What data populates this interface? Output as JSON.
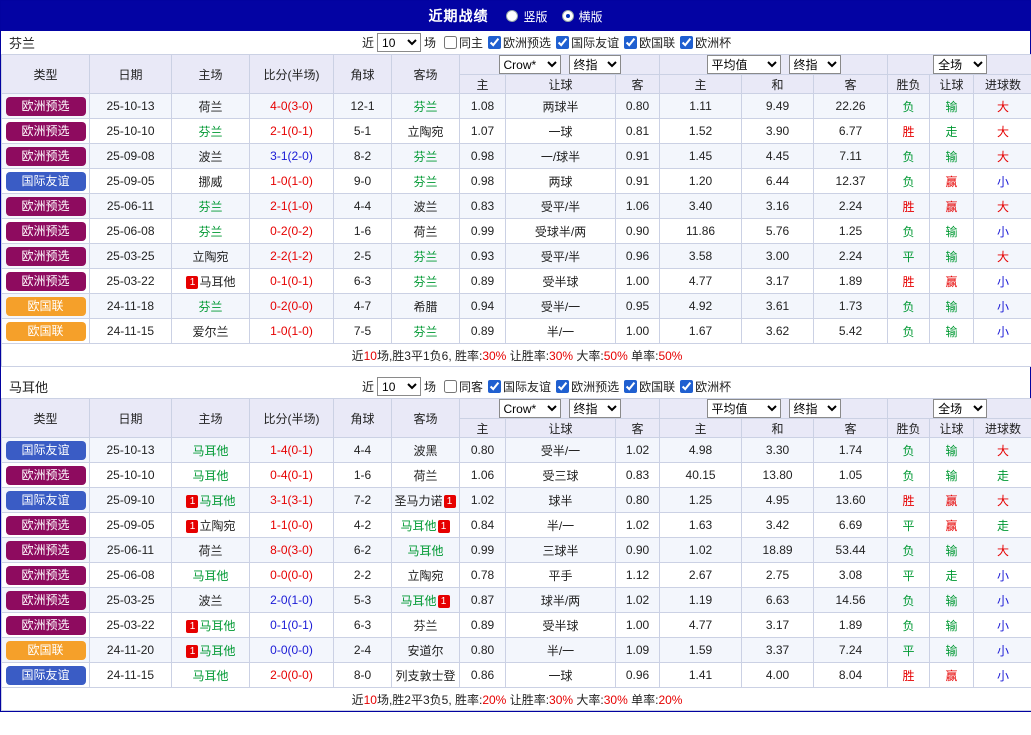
{
  "topbar": {
    "title": "近期战绩",
    "layout_options": [
      {
        "label": "竖版",
        "selected": false
      },
      {
        "label": "横版",
        "selected": true
      }
    ]
  },
  "colors": {
    "badge": {
      "欧洲预选": "#8E0B5F",
      "国际友谊": "#3A5CC5",
      "欧国联": "#F5A02A"
    },
    "status": {
      "red": "#E60000",
      "green": "#009933",
      "blue": "#1A1AD6",
      "black": "#222222"
    },
    "green_team": "#009933"
  },
  "table_headers": {
    "left": [
      "类型",
      "日期",
      "主场",
      "比分(半场)",
      "角球",
      "客场"
    ],
    "asian_sub": [
      "主",
      "让球",
      "客"
    ],
    "euro_sub": [
      "主",
      "和",
      "客"
    ],
    "result_sub": [
      "胜负",
      "让球",
      "进球数"
    ]
  },
  "sections": [
    {
      "team": "芬兰",
      "filter": {
        "near_label": "近",
        "games_value": "10",
        "games_label": "场",
        "same": {
          "label": "同主",
          "checked": false
        },
        "competitions": [
          {
            "label": "欧洲预选",
            "checked": true
          },
          {
            "label": "国际友谊",
            "checked": true
          },
          {
            "label": "欧国联",
            "checked": true
          },
          {
            "label": "欧洲杯",
            "checked": true
          }
        ]
      },
      "dropdowns": {
        "asian": [
          "Crow*",
          "终指"
        ],
        "euro": [
          "平均值",
          "终指"
        ],
        "result": [
          "全场"
        ]
      },
      "rows": [
        {
          "type": "欧洲预选",
          "date": "25-10-13",
          "home": {
            "name": "荷兰"
          },
          "score": [
            "4-0(3-0)",
            "red"
          ],
          "corner": "12-1",
          "away": {
            "name": "芬兰",
            "green": true
          },
          "asian": [
            "1.08",
            "两球半",
            "0.80"
          ],
          "euro": [
            "1.11",
            "9.49",
            "22.26"
          ],
          "results": [
            [
              "负",
              "green"
            ],
            [
              "输",
              "green"
            ],
            [
              "大",
              "red"
            ]
          ]
        },
        {
          "type": "欧洲预选",
          "date": "25-10-10",
          "home": {
            "name": "芬兰",
            "green": true
          },
          "score": [
            "2-1(0-1)",
            "red"
          ],
          "corner": "5-1",
          "away": {
            "name": "立陶宛"
          },
          "asian": [
            "1.07",
            "一球",
            "0.81"
          ],
          "euro": [
            "1.52",
            "3.90",
            "6.77"
          ],
          "results": [
            [
              "胜",
              "red"
            ],
            [
              "走",
              "green"
            ],
            [
              "大",
              "red"
            ]
          ]
        },
        {
          "type": "欧洲预选",
          "date": "25-09-08",
          "home": {
            "name": "波兰"
          },
          "score": [
            "3-1(2-0)",
            "blue"
          ],
          "corner": "8-2",
          "away": {
            "name": "芬兰",
            "green": true
          },
          "asian": [
            "0.98",
            "一/球半",
            "0.91"
          ],
          "euro": [
            "1.45",
            "4.45",
            "7.11"
          ],
          "results": [
            [
              "负",
              "green"
            ],
            [
              "输",
              "green"
            ],
            [
              "大",
              "red"
            ]
          ]
        },
        {
          "type": "国际友谊",
          "date": "25-09-05",
          "home": {
            "name": "挪威"
          },
          "score": [
            "1-0(1-0)",
            "red"
          ],
          "corner": "9-0",
          "away": {
            "name": "芬兰",
            "green": true
          },
          "asian": [
            "0.98",
            "两球",
            "0.91"
          ],
          "euro": [
            "1.20",
            "6.44",
            "12.37"
          ],
          "results": [
            [
              "负",
              "green"
            ],
            [
              "赢",
              "red"
            ],
            [
              "小",
              "blue"
            ]
          ]
        },
        {
          "type": "欧洲预选",
          "date": "25-06-11",
          "home": {
            "name": "芬兰",
            "green": true
          },
          "score": [
            "2-1(1-0)",
            "red"
          ],
          "corner": "4-4",
          "away": {
            "name": "波兰"
          },
          "asian": [
            "0.83",
            "受平/半",
            "1.06"
          ],
          "euro": [
            "3.40",
            "3.16",
            "2.24"
          ],
          "results": [
            [
              "胜",
              "red"
            ],
            [
              "赢",
              "red"
            ],
            [
              "大",
              "red"
            ]
          ]
        },
        {
          "type": "欧洲预选",
          "date": "25-06-08",
          "home": {
            "name": "芬兰",
            "green": true
          },
          "score": [
            "0-2(0-2)",
            "red"
          ],
          "corner": "1-6",
          "away": {
            "name": "荷兰"
          },
          "asian": [
            "0.99",
            "受球半/两",
            "0.90"
          ],
          "euro": [
            "11.86",
            "5.76",
            "1.25"
          ],
          "results": [
            [
              "负",
              "green"
            ],
            [
              "输",
              "green"
            ],
            [
              "小",
              "blue"
            ]
          ]
        },
        {
          "type": "欧洲预选",
          "date": "25-03-25",
          "home": {
            "name": "立陶宛"
          },
          "score": [
            "2-2(1-2)",
            "red"
          ],
          "corner": "2-5",
          "away": {
            "name": "芬兰",
            "green": true
          },
          "asian": [
            "0.93",
            "受平/半",
            "0.96"
          ],
          "euro": [
            "3.58",
            "3.00",
            "2.24"
          ],
          "results": [
            [
              "平",
              "green"
            ],
            [
              "输",
              "green"
            ],
            [
              "大",
              "red"
            ]
          ]
        },
        {
          "type": "欧洲预选",
          "date": "25-03-22",
          "home": {
            "name": "马耳他",
            "card_before": "1"
          },
          "score": [
            "0-1(0-1)",
            "red"
          ],
          "corner": "6-3",
          "away": {
            "name": "芬兰",
            "green": true
          },
          "asian": [
            "0.89",
            "受半球",
            "1.00"
          ],
          "euro": [
            "4.77",
            "3.17",
            "1.89"
          ],
          "results": [
            [
              "胜",
              "red"
            ],
            [
              "赢",
              "red"
            ],
            [
              "小",
              "blue"
            ]
          ]
        },
        {
          "type": "欧国联",
          "date": "24-11-18",
          "home": {
            "name": "芬兰",
            "green": true
          },
          "score": [
            "0-2(0-0)",
            "red"
          ],
          "corner": "4-7",
          "away": {
            "name": "希腊"
          },
          "asian": [
            "0.94",
            "受半/一",
            "0.95"
          ],
          "euro": [
            "4.92",
            "3.61",
            "1.73"
          ],
          "results": [
            [
              "负",
              "green"
            ],
            [
              "输",
              "green"
            ],
            [
              "小",
              "blue"
            ]
          ]
        },
        {
          "type": "欧国联",
          "date": "24-11-15",
          "home": {
            "name": "爱尔兰"
          },
          "score": [
            "1-0(1-0)",
            "red"
          ],
          "corner": "7-5",
          "away": {
            "name": "芬兰",
            "green": true
          },
          "asian": [
            "0.89",
            "半/一",
            "1.00"
          ],
          "euro": [
            "1.67",
            "3.62",
            "5.42"
          ],
          "results": [
            [
              "负",
              "green"
            ],
            [
              "输",
              "green"
            ],
            [
              "小",
              "blue"
            ]
          ]
        }
      ],
      "summary": [
        [
          "近",
          ""
        ],
        [
          "10",
          "red"
        ],
        [
          "场,胜3平1负6, 胜率:",
          ""
        ],
        [
          "30%",
          "red"
        ],
        [
          " 让胜率:",
          ""
        ],
        [
          "30%",
          "red"
        ],
        [
          " 大率:",
          ""
        ],
        [
          "50%",
          "red"
        ],
        [
          " 单率:",
          ""
        ],
        [
          "50%",
          "red"
        ]
      ]
    },
    {
      "team": "马耳他",
      "filter": {
        "near_label": "近",
        "games_value": "10",
        "games_label": "场",
        "same": {
          "label": "同客",
          "checked": false
        },
        "competitions": [
          {
            "label": "国际友谊",
            "checked": true
          },
          {
            "label": "欧洲预选",
            "checked": true
          },
          {
            "label": "欧国联",
            "checked": true
          },
          {
            "label": "欧洲杯",
            "checked": true
          }
        ]
      },
      "dropdowns": {
        "asian": [
          "Crow*",
          "终指"
        ],
        "euro": [
          "平均值",
          "终指"
        ],
        "result": [
          "全场"
        ]
      },
      "rows": [
        {
          "type": "国际友谊",
          "date": "25-10-13",
          "home": {
            "name": "马耳他",
            "green": true
          },
          "score": [
            "1-4(0-1)",
            "red"
          ],
          "corner": "4-4",
          "away": {
            "name": "波黑"
          },
          "asian": [
            "0.80",
            "受半/一",
            "1.02"
          ],
          "euro": [
            "4.98",
            "3.30",
            "1.74"
          ],
          "results": [
            [
              "负",
              "green"
            ],
            [
              "输",
              "green"
            ],
            [
              "大",
              "red"
            ]
          ]
        },
        {
          "type": "欧洲预选",
          "date": "25-10-10",
          "home": {
            "name": "马耳他",
            "green": true
          },
          "score": [
            "0-4(0-1)",
            "red"
          ],
          "corner": "1-6",
          "away": {
            "name": "荷兰"
          },
          "asian": [
            "1.06",
            "受三球",
            "0.83"
          ],
          "euro": [
            "40.15",
            "13.80",
            "1.05"
          ],
          "results": [
            [
              "负",
              "green"
            ],
            [
              "输",
              "green"
            ],
            [
              "走",
              "green"
            ]
          ]
        },
        {
          "type": "国际友谊",
          "date": "25-09-10",
          "home": {
            "name": "马耳他",
            "green": true,
            "card_before": "1"
          },
          "score": [
            "3-1(3-1)",
            "red"
          ],
          "corner": "7-2",
          "away": {
            "name": "圣马力诺",
            "card_after": "1"
          },
          "asian": [
            "1.02",
            "球半",
            "0.80"
          ],
          "euro": [
            "1.25",
            "4.95",
            "13.60"
          ],
          "results": [
            [
              "胜",
              "red"
            ],
            [
              "赢",
              "red"
            ],
            [
              "大",
              "red"
            ]
          ]
        },
        {
          "type": "欧洲预选",
          "date": "25-09-05",
          "home": {
            "name": "立陶宛",
            "card_before": "1"
          },
          "score": [
            "1-1(0-0)",
            "red"
          ],
          "corner": "4-2",
          "away": {
            "name": "马耳他",
            "green": true,
            "card_after": "1"
          },
          "asian": [
            "0.84",
            "半/一",
            "1.02"
          ],
          "euro": [
            "1.63",
            "3.42",
            "6.69"
          ],
          "results": [
            [
              "平",
              "green"
            ],
            [
              "赢",
              "red"
            ],
            [
              "走",
              "green"
            ]
          ]
        },
        {
          "type": "欧洲预选",
          "date": "25-06-11",
          "home": {
            "name": "荷兰"
          },
          "score": [
            "8-0(3-0)",
            "red"
          ],
          "corner": "6-2",
          "away": {
            "name": "马耳他",
            "green": true
          },
          "asian": [
            "0.99",
            "三球半",
            "0.90"
          ],
          "euro": [
            "1.02",
            "18.89",
            "53.44"
          ],
          "results": [
            [
              "负",
              "green"
            ],
            [
              "输",
              "green"
            ],
            [
              "大",
              "red"
            ]
          ]
        },
        {
          "type": "欧洲预选",
          "date": "25-06-08",
          "home": {
            "name": "马耳他",
            "green": true
          },
          "score": [
            "0-0(0-0)",
            "red"
          ],
          "corner": "2-2",
          "away": {
            "name": "立陶宛"
          },
          "asian": [
            "0.78",
            "平手",
            "1.12"
          ],
          "euro": [
            "2.67",
            "2.75",
            "3.08"
          ],
          "results": [
            [
              "平",
              "green"
            ],
            [
              "走",
              "green"
            ],
            [
              "小",
              "blue"
            ]
          ]
        },
        {
          "type": "欧洲预选",
          "date": "25-03-25",
          "home": {
            "name": "波兰"
          },
          "score": [
            "2-0(1-0)",
            "blue"
          ],
          "corner": "5-3",
          "away": {
            "name": "马耳他",
            "green": true,
            "card_after": "1"
          },
          "asian": [
            "0.87",
            "球半/两",
            "1.02"
          ],
          "euro": [
            "1.19",
            "6.63",
            "14.56"
          ],
          "results": [
            [
              "负",
              "green"
            ],
            [
              "输",
              "green"
            ],
            [
              "小",
              "blue"
            ]
          ]
        },
        {
          "type": "欧洲预选",
          "date": "25-03-22",
          "home": {
            "name": "马耳他",
            "green": true,
            "card_before": "1"
          },
          "score": [
            "0-1(0-1)",
            "blue"
          ],
          "corner": "6-3",
          "away": {
            "name": "芬兰"
          },
          "asian": [
            "0.89",
            "受半球",
            "1.00"
          ],
          "euro": [
            "4.77",
            "3.17",
            "1.89"
          ],
          "results": [
            [
              "负",
              "green"
            ],
            [
              "输",
              "green"
            ],
            [
              "小",
              "blue"
            ]
          ]
        },
        {
          "type": "欧国联",
          "date": "24-11-20",
          "home": {
            "name": "马耳他",
            "green": true,
            "card_before": "1"
          },
          "score": [
            "0-0(0-0)",
            "blue"
          ],
          "corner": "2-4",
          "away": {
            "name": "安道尔"
          },
          "asian": [
            "0.80",
            "半/一",
            "1.09"
          ],
          "euro": [
            "1.59",
            "3.37",
            "7.24"
          ],
          "results": [
            [
              "平",
              "green"
            ],
            [
              "输",
              "green"
            ],
            [
              "小",
              "blue"
            ]
          ]
        },
        {
          "type": "国际友谊",
          "date": "24-11-15",
          "home": {
            "name": "马耳他",
            "green": true
          },
          "score": [
            "2-0(0-0)",
            "red"
          ],
          "corner": "8-0",
          "away": {
            "name": "列支敦士登"
          },
          "asian": [
            "0.86",
            "一球",
            "0.96"
          ],
          "euro": [
            "1.41",
            "4.00",
            "8.04"
          ],
          "results": [
            [
              "胜",
              "red"
            ],
            [
              "赢",
              "red"
            ],
            [
              "小",
              "blue"
            ]
          ]
        }
      ],
      "summary": [
        [
          "近",
          ""
        ],
        [
          "10",
          "red"
        ],
        [
          "场,胜2平3负5, 胜率:",
          ""
        ],
        [
          "20%",
          "red"
        ],
        [
          " 让胜率:",
          ""
        ],
        [
          "30%",
          "red"
        ],
        [
          " 大率:",
          ""
        ],
        [
          "30%",
          "red"
        ],
        [
          " 单率:",
          ""
        ],
        [
          "20%",
          "red"
        ]
      ]
    }
  ]
}
